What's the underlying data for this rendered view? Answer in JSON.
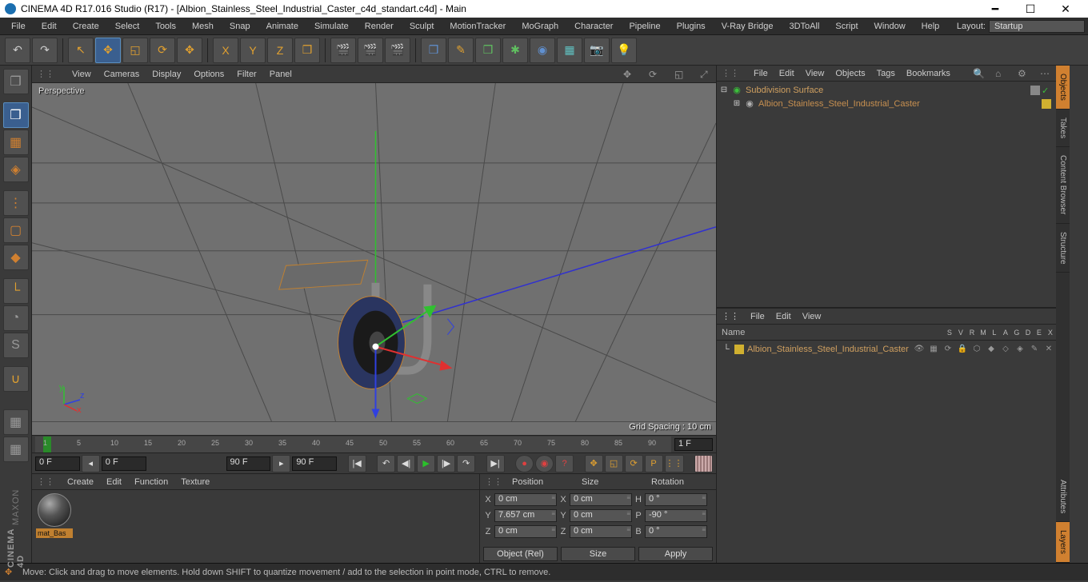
{
  "titlebar": {
    "title": "CINEMA 4D R17.016 Studio (R17) - [Albion_Stainless_Steel_Industrial_Caster_c4d_standart.c4d] - Main"
  },
  "menubar": {
    "items": [
      "File",
      "Edit",
      "Create",
      "Select",
      "Tools",
      "Mesh",
      "Snap",
      "Animate",
      "Simulate",
      "Render",
      "Sculpt",
      "MotionTracker",
      "MoGraph",
      "Character",
      "Pipeline",
      "Plugins",
      "V-Ray Bridge",
      "3DToAll",
      "Script",
      "Window",
      "Help"
    ],
    "layout_label": "Layout:",
    "layout_value": "Startup"
  },
  "viewport": {
    "menus": [
      "View",
      "Cameras",
      "Display",
      "Options",
      "Filter",
      "Panel"
    ],
    "label": "Perspective",
    "grid_spacing": "Grid Spacing : 10 cm"
  },
  "timeline": {
    "ticks": [
      "1",
      "5",
      "10",
      "15",
      "20",
      "25",
      "30",
      "35",
      "40",
      "45",
      "50",
      "55",
      "60",
      "65",
      "70",
      "75",
      "80",
      "85",
      "90"
    ],
    "current_frame_box": "1 F"
  },
  "playback": {
    "range_start": "0 F",
    "slider_start": "0 F",
    "slider_end": "90 F",
    "range_end": "90 F"
  },
  "materials": {
    "menus": [
      "Create",
      "Edit",
      "Function",
      "Texture"
    ],
    "items": [
      {
        "name": "mat_Bas"
      }
    ]
  },
  "coords": {
    "headers": [
      "Position",
      "Size",
      "Rotation"
    ],
    "rows": [
      {
        "axis": "X",
        "pos": "0 cm",
        "size": "0 cm",
        "rlabel": "H",
        "rot": "0 °"
      },
      {
        "axis": "Y",
        "pos": "7.657 cm",
        "size": "0 cm",
        "rlabel": "P",
        "rot": "-90 °"
      },
      {
        "axis": "Z",
        "pos": "0 cm",
        "size": "0 cm",
        "rlabel": "B",
        "rot": "0 °"
      }
    ],
    "mode_left": "Object (Rel)",
    "mode_mid": "Size",
    "apply": "Apply"
  },
  "object_manager": {
    "menus": [
      "File",
      "Edit",
      "View",
      "Objects",
      "Tags",
      "Bookmarks"
    ],
    "tree": [
      {
        "name": "Subdivision Surface",
        "indent": 0,
        "expander": "⊟",
        "icon_color": "#3ac03a",
        "selected": true
      },
      {
        "name": "Albion_Stainless_Steel_Industrial_Caster",
        "indent": 1,
        "expander": "⊞",
        "icon_color": "#b0b0b0",
        "selected": false
      }
    ]
  },
  "layers": {
    "menus": [
      "File",
      "Edit",
      "View"
    ],
    "name_header": "Name",
    "cols": [
      "S",
      "V",
      "R",
      "M",
      "L",
      "A",
      "G",
      "D",
      "E",
      "X"
    ],
    "rows": [
      {
        "name": "Albion_Stainless_Steel_Industrial_Caster"
      }
    ]
  },
  "right_tabs": {
    "top": [
      "Objects",
      "Takes",
      "Content Browser",
      "Structure"
    ],
    "bottom": [
      "Attributes",
      "Layers"
    ],
    "active_top": 0,
    "active_bottom": 1
  },
  "statusbar": {
    "hint": "Move: Click and drag to move elements. Hold down SHIFT to quantize movement / add to the selection in point mode, CTRL to remove."
  },
  "brand": {
    "line1": "CINEMA 4D",
    "line2": "MAXON"
  }
}
